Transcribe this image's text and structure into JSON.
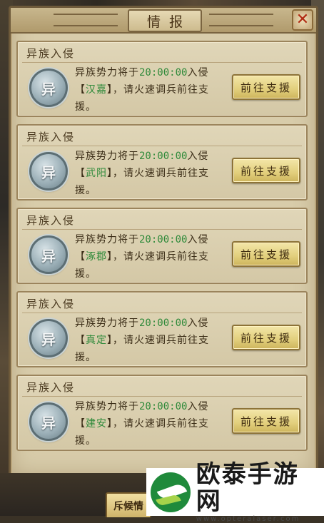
{
  "window": {
    "title": "情报",
    "close_glyph": "✕"
  },
  "reports": [
    {
      "heading": "异族入侵",
      "emblem": "异",
      "line_prefix": "异族势力将于",
      "time": "20:00:00",
      "line_join": "入侵",
      "bracket_open": "【",
      "place": "汉嘉",
      "bracket_close": "】",
      "line_suffix": "，请火速调兵前往支援。",
      "button": "前往支援"
    },
    {
      "heading": "异族入侵",
      "emblem": "异",
      "line_prefix": "异族势力将于",
      "time": "20:00:00",
      "line_join": "入侵",
      "bracket_open": "【",
      "place": "武阳",
      "bracket_close": "】",
      "line_suffix": "，请火速调兵前往支援。",
      "button": "前往支援"
    },
    {
      "heading": "异族入侵",
      "emblem": "异",
      "line_prefix": "异族势力将于",
      "time": "20:00:00",
      "line_join": "入侵",
      "bracket_open": "【",
      "place": "涿郡",
      "bracket_close": "】",
      "line_suffix": "，请火速调兵前往支援。",
      "button": "前往支援"
    },
    {
      "heading": "异族入侵",
      "emblem": "异",
      "line_prefix": "异族势力将于",
      "time": "20:00:00",
      "line_join": "入侵",
      "bracket_open": "【",
      "place": "真定",
      "bracket_close": "】",
      "line_suffix": "，请火速调兵前往支援。",
      "button": "前往支援"
    },
    {
      "heading": "异族入侵",
      "emblem": "异",
      "line_prefix": "异族势力将于",
      "time": "20:00:00",
      "line_join": "入侵",
      "bracket_open": "【",
      "place": "建安",
      "bracket_close": "】",
      "line_suffix": "，请火速调兵前往支援。",
      "button": "前往支援"
    }
  ],
  "bottom_tab": "斥候情",
  "watermark": {
    "title": "欧泰手游网",
    "url": "www.opteralaser.com"
  },
  "colors": {
    "place_text": "#2f8a3a",
    "time_text": "#2f8a3a",
    "close_x": "#b02a12",
    "button_face": "#e2cf7c"
  }
}
